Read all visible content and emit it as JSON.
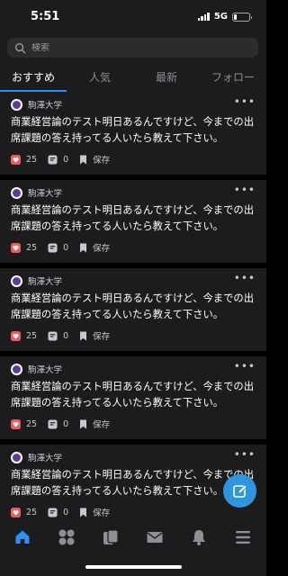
{
  "status": {
    "time": "5:51",
    "network": "5G",
    "battery_level": 0.2
  },
  "search": {
    "placeholder": "検索"
  },
  "tabs": [
    {
      "label": "おすすめ",
      "active": true
    },
    {
      "label": "人気",
      "active": false
    },
    {
      "label": "最新",
      "active": false
    },
    {
      "label": "フォロー",
      "active": false
    }
  ],
  "posts": [
    {
      "school": "駒澤大学",
      "text": "商業経営論のテスト明日あるんですけど、今までの出席課題の答え持ってる人いたら教えて下さい。",
      "likes": "25",
      "comments": "0",
      "save_label": "保存"
    },
    {
      "school": "駒澤大学",
      "text": "商業経営論のテスト明日あるんですけど、今までの出席課題の答え持ってる人いたら教えて下さい。",
      "likes": "25",
      "comments": "0",
      "save_label": "保存"
    },
    {
      "school": "駒澤大学",
      "text": "商業経営論のテスト明日あるんですけど、今までの出席課題の答え持ってる人いたら教えて下さい。",
      "likes": "25",
      "comments": "0",
      "save_label": "保存"
    },
    {
      "school": "駒澤大学",
      "text": "商業経営論のテスト明日あるんですけど、今までの出席課題の答え持ってる人いたら教えて下さい。",
      "likes": "25",
      "comments": "0",
      "save_label": "保存"
    },
    {
      "school": "駒澤大学",
      "text": "商業経営論のテスト明日あるんですけど、今までの出席課題の答え持ってる人いたら教えて下さい。",
      "likes": "25",
      "comments": "0",
      "save_label": "保存"
    }
  ],
  "nav": [
    {
      "icon": "home-icon",
      "active": true
    },
    {
      "icon": "grid-icon",
      "active": false
    },
    {
      "icon": "cards-icon",
      "active": false
    },
    {
      "icon": "mail-icon",
      "active": false
    },
    {
      "icon": "bell-icon",
      "active": false
    },
    {
      "icon": "menu-icon",
      "active": false
    }
  ],
  "colors": {
    "accent": "#2f8ff2",
    "like": "#ef5b5b",
    "fab": "#2e96e0"
  }
}
